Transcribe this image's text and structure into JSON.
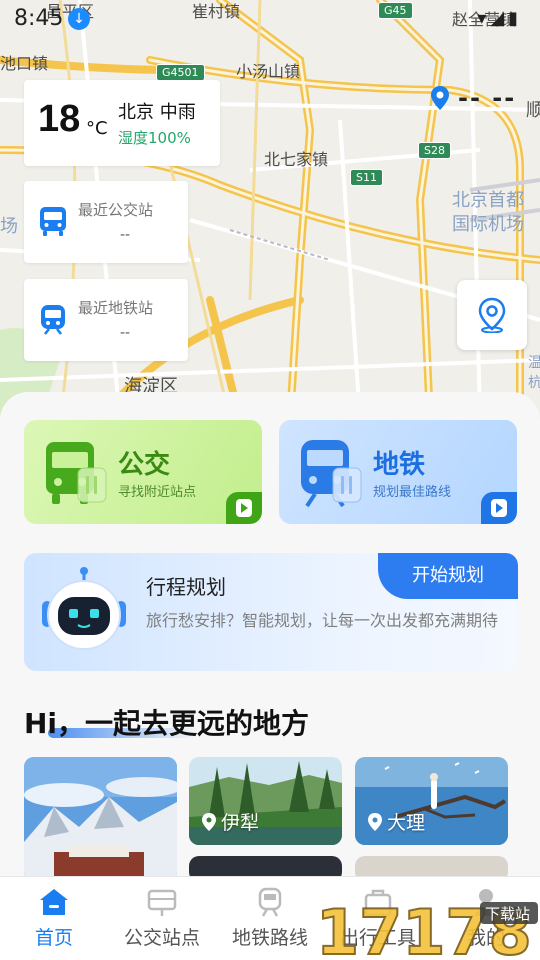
{
  "status_bar": {
    "time": "8:45"
  },
  "map": {
    "labels": [
      "昌平区",
      "崔村镇",
      "赵全营镇",
      "池口镇",
      "小汤山镇",
      "北七家镇",
      "北京首都",
      "国际机场",
      "海淀区",
      "顺",
      "场",
      "温",
      "杭"
    ],
    "shields": [
      "G45",
      "G4501",
      "S28",
      "S11"
    ]
  },
  "weather": {
    "temp": "18",
    "unit": "°C",
    "city_weather": "北京 中雨",
    "humidity": "湿度100%"
  },
  "location": {
    "text": "-- --"
  },
  "nearest_bus": {
    "title": "最近公交站",
    "value": "--"
  },
  "nearest_metro": {
    "title": "最近地铁站",
    "value": "--"
  },
  "modes": {
    "bus": {
      "title": "公交",
      "subtitle": "寻找附近站点"
    },
    "metro": {
      "title": "地铁",
      "subtitle": "规划最佳路线"
    }
  },
  "plan": {
    "title": "行程规划",
    "description": "旅行愁安排？智能规划，让每一次出发都充满期待",
    "button": "开始规划"
  },
  "section": {
    "title": "Hi，一起去更远的地方"
  },
  "destinations": [
    {
      "name": ""
    },
    {
      "name": "伊犁"
    },
    {
      "name": "大理"
    }
  ],
  "nav": {
    "items": [
      {
        "label": "首页",
        "icon": "home-icon",
        "active": true
      },
      {
        "label": "公交站点",
        "icon": "bus-stop-icon",
        "active": false
      },
      {
        "label": "地铁路线",
        "icon": "metro-icon",
        "active": false
      },
      {
        "label": "出行工具",
        "icon": "toolbox-icon",
        "active": false
      },
      {
        "label": "我的",
        "icon": "user-icon",
        "active": false
      }
    ]
  },
  "watermark": {
    "text": "17178",
    "badge": "下载站"
  },
  "colors": {
    "accent": "#1a7ef0",
    "bus_green": "#3a8a12",
    "metro_blue": "#1c6fe0",
    "humidity_green": "#23a869"
  }
}
